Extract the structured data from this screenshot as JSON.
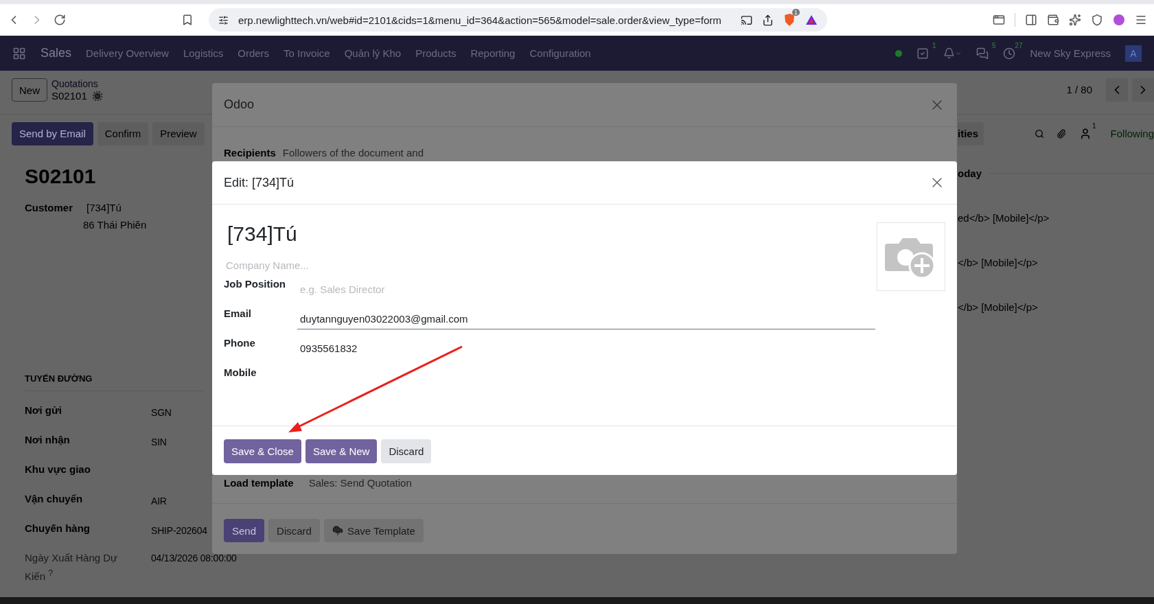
{
  "browser": {
    "url": "erp.newlighttech.vn/web#id=2101&cids=1&menu_id=364&action=565&model=sale.order&view_type=form",
    "shield_badge": "1"
  },
  "navbar": {
    "app": "Sales",
    "menu": [
      "Delivery Overview",
      "Logistics",
      "Orders",
      "To Invoice",
      "Quản lý Kho",
      "Products",
      "Reporting",
      "Configuration"
    ],
    "systray": [
      {
        "kind": "activity",
        "badge": "1"
      },
      {
        "kind": "bell"
      },
      {
        "kind": "chat",
        "badge": "5"
      },
      {
        "kind": "clock",
        "badge": "27"
      }
    ],
    "company": "New Sky Express",
    "avatar": "A"
  },
  "control_panel": {
    "new_button": "New",
    "breadcrumb": "Quotations",
    "record": "S02101",
    "pager": "1 / 80"
  },
  "actions": [
    {
      "label": "Send by Email",
      "primary": true
    },
    {
      "label": "Confirm",
      "primary": false
    },
    {
      "label": "Preview",
      "primary": false
    }
  ],
  "chatter": {
    "tab": "ities",
    "follower_count": "1",
    "following": "Following",
    "day": "oday",
    "messages": [
      "ed</b> [Mobile]</p>",
      "</b> [Mobile]</p>",
      "</b> [Mobile]</p>"
    ]
  },
  "form": {
    "title": "S02101",
    "customer_label": "Customer",
    "customer": [
      "[734]Tú",
      "86 Thái Phiên"
    ],
    "section": "TUYẾN ĐƯỜNG",
    "fields": [
      {
        "label": "Nơi gửi",
        "value": "SGN"
      },
      {
        "label": "Nơi nhận",
        "value": "SIN"
      },
      {
        "label": "Khu vực giao"
      },
      {
        "label": "Vận chuyển",
        "value": "AIR"
      },
      {
        "label": "Chuyến hàng",
        "value": "SHIP-202604"
      },
      {
        "label": "Ngày Xuất Hàng Dự Kiến $^{?}$",
        "value": "04/13/2026 08:00:00",
        "muted": true
      }
    ]
  },
  "composer": {
    "title": "Odoo",
    "recipients_label": "Recipients",
    "recipients": "Followers of the document and",
    "template_label": "Load template",
    "template": "Sales: Send Quotation",
    "buttons": [
      {
        "label": "Send",
        "primary": true,
        "kind": "plain"
      },
      {
        "label": "Discard",
        "primary": false,
        "kind": "plain"
      },
      {
        "label": "Save Template",
        "primary": false,
        "kind": "upload"
      }
    ]
  },
  "edit_dialog": {
    "title": "Edit: [734]Tú",
    "name": "[734]Tú",
    "company_placeholder": "Company Name...",
    "fields": [
      {
        "label": "Job Position",
        "placeholder": "e.g. Sales Director",
        "focused": false
      },
      {
        "label": "Email",
        "value": "duytannguyen03022003@gmail.com",
        "focused": true
      },
      {
        "label": "Phone",
        "value": "0935561832",
        "focused": false
      },
      {
        "label": "Mobile",
        "focused": false
      }
    ],
    "buttons": [
      {
        "label": "Save & Close",
        "primary": true
      },
      {
        "label": "Save & New",
        "primary": true
      },
      {
        "label": "Discard",
        "primary": false
      }
    ]
  }
}
